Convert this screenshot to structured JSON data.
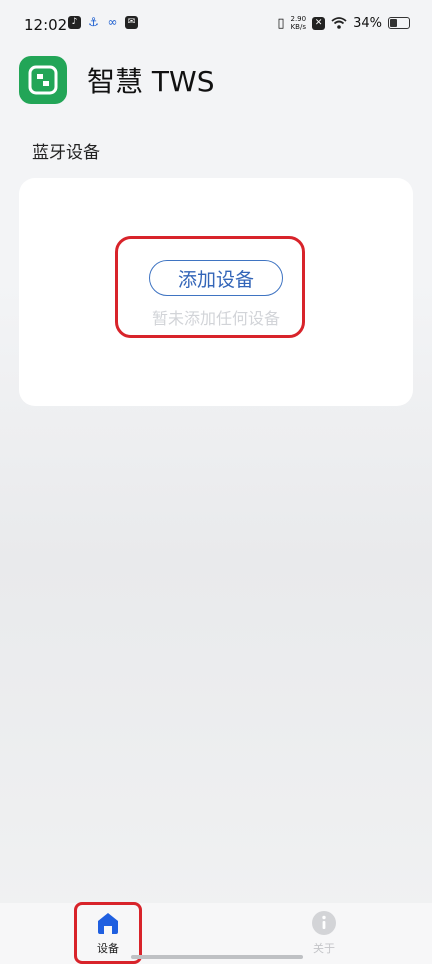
{
  "status_bar": {
    "time": "12:02",
    "network_speed_value": "2.90",
    "network_speed_unit": "KB/s",
    "battery_percent": "34%",
    "battery_level": 0.34
  },
  "header": {
    "title": "智慧 TWS"
  },
  "section": {
    "label": "蓝牙设备"
  },
  "device_card": {
    "add_button_label": "添加设备",
    "empty_hint": "暂未添加任何设备"
  },
  "tabs": [
    {
      "label": "设备",
      "icon": "home-icon",
      "active": true
    },
    {
      "label": "关于",
      "icon": "info-icon",
      "active": false
    }
  ],
  "colors": {
    "accent": "#1f5fe0",
    "logo_green": "#22a557",
    "highlight_red": "#d8232a",
    "button_blue": "#3365b8"
  }
}
